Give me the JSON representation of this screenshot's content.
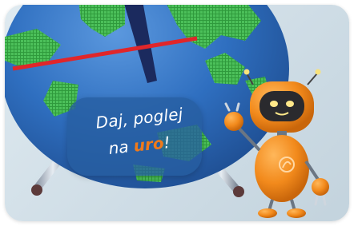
{
  "card": {
    "message_line1": "Daj, poglej",
    "message_line2_prefix": "na ",
    "message_line2_accent": "uro",
    "message_line2_suffix": "!"
  },
  "colors": {
    "clock_face": "#2f6fc0",
    "land": "#3fae4a",
    "second_hand": "#e0262a",
    "clock_hand": "#1b2a5e",
    "robot_body": "#f28a1c",
    "accent_text": "#f07a1a"
  },
  "icons": {
    "clock": "alarm-clock-globe-icon",
    "robot": "robot-mascot-icon",
    "robot_logo": "robot-chest-logo-icon"
  }
}
